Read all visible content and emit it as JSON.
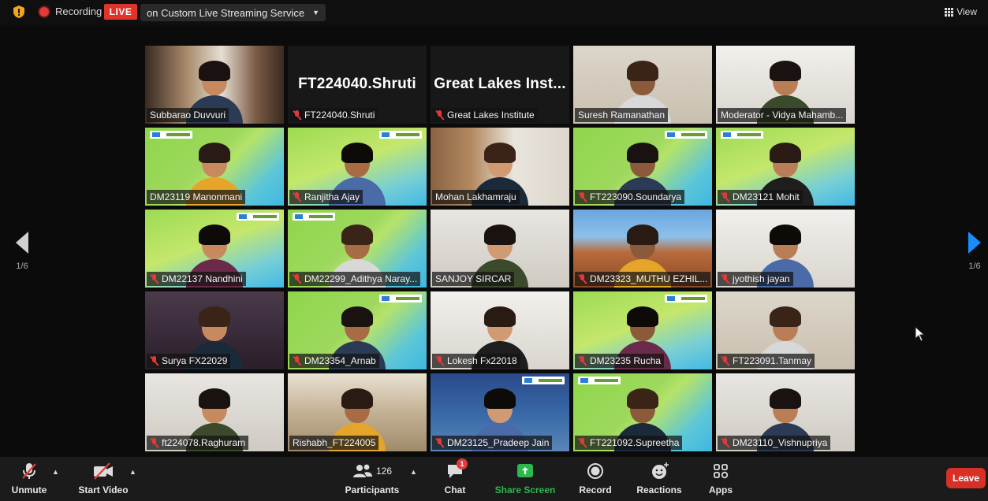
{
  "topbar": {
    "recording_label": "Recording",
    "live_label": "LIVE",
    "stream_service": "on Custom Live Streaming Service",
    "view_label": "View"
  },
  "pager": {
    "left_page": "1/6",
    "right_page": "1/6"
  },
  "tiles": [
    {
      "name": "Subbarao Duvvuri",
      "muted": false,
      "bg": "office",
      "big_name": "",
      "highlight": false,
      "logo": false
    },
    {
      "name": "FT224040.Shruti",
      "muted": true,
      "bg": "dark",
      "big_name": "FT224040.Shruti",
      "highlight": false,
      "logo": false
    },
    {
      "name": "Great Lakes Institute",
      "muted": true,
      "bg": "dark",
      "big_name": "Great Lakes Inst...",
      "highlight": false,
      "logo": false
    },
    {
      "name": "Suresh Ramanathan",
      "muted": false,
      "bg": "wall",
      "big_name": "",
      "highlight": false,
      "logo": false
    },
    {
      "name": "Moderator - Vidya Mahamb...",
      "muted": false,
      "bg": "light",
      "big_name": "",
      "highlight": true,
      "logo": false
    },
    {
      "name": "DM23119 Manonmani",
      "muted": false,
      "bg": "green",
      "big_name": "",
      "highlight": false,
      "logo": true
    },
    {
      "name": "Ranjitha Ajay",
      "muted": true,
      "bg": "green2",
      "big_name": "",
      "highlight": false,
      "logo": true
    },
    {
      "name": "Mohan Lakhamraju",
      "muted": false,
      "bg": "mohan",
      "big_name": "",
      "highlight": false,
      "logo": false
    },
    {
      "name": "FT223090.Soundarya",
      "muted": true,
      "bg": "green",
      "big_name": "",
      "highlight": false,
      "logo": true
    },
    {
      "name": "DM23121 Mohit",
      "muted": true,
      "bg": "green2",
      "big_name": "",
      "highlight": false,
      "logo": true
    },
    {
      "name": "DM22137 Nandhini",
      "muted": true,
      "bg": "green2",
      "big_name": "",
      "highlight": false,
      "logo": true
    },
    {
      "name": "DM22299_Adithya Naray...",
      "muted": true,
      "bg": "green",
      "big_name": "",
      "highlight": false,
      "logo": true
    },
    {
      "name": "SANJOY SIRCAR",
      "muted": false,
      "bg": "room",
      "big_name": "",
      "highlight": false,
      "logo": false
    },
    {
      "name": "DM23323_MUTHU EZHIL...",
      "muted": true,
      "bg": "rock",
      "big_name": "",
      "highlight": false,
      "logo": false
    },
    {
      "name": "jyothish jayan",
      "muted": true,
      "bg": "light",
      "big_name": "",
      "highlight": false,
      "logo": false
    },
    {
      "name": "Surya FX22029",
      "muted": true,
      "bg": "purple",
      "big_name": "",
      "highlight": false,
      "logo": false
    },
    {
      "name": "DM23354_Arnab",
      "muted": true,
      "bg": "green",
      "big_name": "",
      "highlight": false,
      "logo": true
    },
    {
      "name": "Lokesh Fx22018",
      "muted": true,
      "bg": "light",
      "big_name": "",
      "highlight": false,
      "logo": false
    },
    {
      "name": "DM23235 Rucha",
      "muted": true,
      "bg": "green2",
      "big_name": "",
      "highlight": false,
      "logo": true
    },
    {
      "name": "FT223091.Tanmay",
      "muted": true,
      "bg": "wall",
      "big_name": "",
      "highlight": false,
      "logo": false
    },
    {
      "name": "ft224078.Raghuram",
      "muted": true,
      "bg": "room",
      "big_name": "",
      "highlight": false,
      "logo": false
    },
    {
      "name": "Rishabh_FT224005",
      "muted": false,
      "bg": "banner",
      "big_name": "",
      "highlight": false,
      "logo": false
    },
    {
      "name": "DM23125_Pradeep Jain",
      "muted": true,
      "bg": "campus",
      "big_name": "",
      "highlight": false,
      "logo": true
    },
    {
      "name": "FT221092.Supreetha",
      "muted": true,
      "bg": "green",
      "big_name": "",
      "highlight": false,
      "logo": true
    },
    {
      "name": "DM23110_Vishnupriya",
      "muted": true,
      "bg": "room",
      "big_name": "",
      "highlight": false,
      "logo": false
    }
  ],
  "toolbar": {
    "unmute_label": "Unmute",
    "start_video_label": "Start Video",
    "participants_label": "Participants",
    "participants_count": "126",
    "chat_label": "Chat",
    "chat_badge": "1",
    "share_screen_label": "Share Screen",
    "record_label": "Record",
    "reactions_label": "Reactions",
    "apps_label": "Apps",
    "leave_label": "Leave"
  },
  "colors": {
    "live_red": "#e0332c",
    "share_green": "#2db84d",
    "next_blue": "#1a8cff",
    "leave_red": "#d73027",
    "active_speaker": "#d9c94a"
  }
}
